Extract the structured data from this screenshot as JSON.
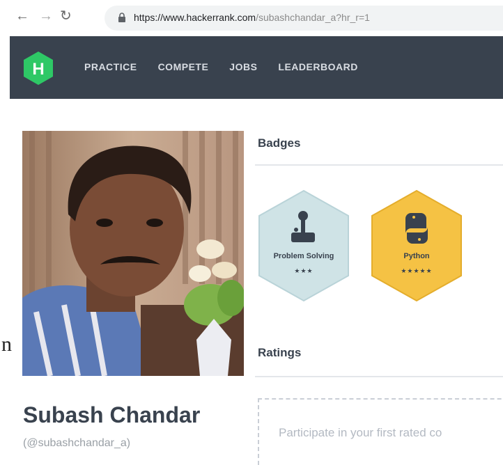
{
  "browser": {
    "back_icon": "arrow-left-icon",
    "forward_icon": "arrow-right-icon",
    "reload_icon": "reload-icon",
    "url_host": "https://www.hackerrank.com",
    "url_path": "/subashchandar_a?hr_r=1"
  },
  "nav": {
    "logo_letter": "H",
    "items": [
      "PRACTICE",
      "COMPETE",
      "JOBS",
      "LEADERBOARD"
    ]
  },
  "profile": {
    "name": "Subash Chandar",
    "handle": "(@subashchandar_a)",
    "stray_char": "n"
  },
  "badges": {
    "title": "Badges",
    "items": [
      {
        "label": "Problem Solving",
        "stars": "★★★",
        "color": "#cfe3e6",
        "icon": "joystick-icon"
      },
      {
        "label": "Python",
        "stars": "★★★★★",
        "color": "#f5c244",
        "icon": "python-icon"
      }
    ]
  },
  "ratings": {
    "title": "Ratings",
    "participate_text": "Participate in your first rated co"
  },
  "colors": {
    "nav_bg": "#39424e",
    "logo_green": "#2ec866",
    "text_dark": "#39424e"
  }
}
